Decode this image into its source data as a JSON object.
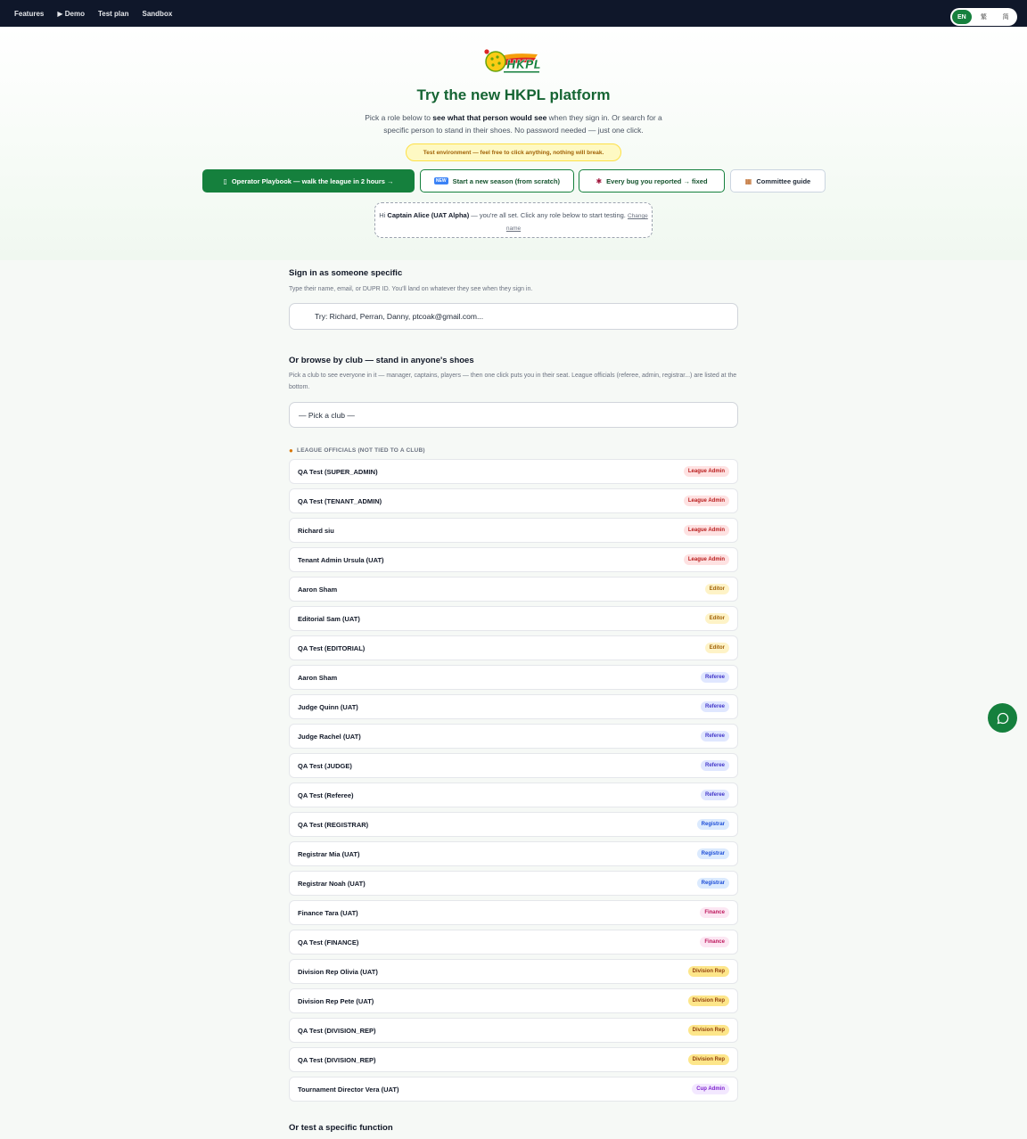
{
  "nav": {
    "links": [
      "Features",
      "▶ Demo",
      "Test plan",
      "Sandbox"
    ],
    "languages": [
      "EN",
      "繁",
      "简"
    ],
    "active_language": "EN"
  },
  "hero": {
    "logo_text": "HKPL",
    "title": "Try the new HKPL platform",
    "subtitle_part1": "Pick a role below to ",
    "subtitle_bold": "see what that person would see",
    "subtitle_part2": " when they sign in. Or search for a specific person to stand in their shoes. No password needed — just one click.",
    "test_env": "Test environment — feel free to click anything, nothing will break.",
    "buttons": {
      "playbook": "Operator Playbook — walk the league in 2 hours →",
      "new_season": "Start a new season (from scratch)",
      "bugs": "Every bug you reported → fixed",
      "committee": "Committee guide"
    },
    "welcome": {
      "hi": "Hi ",
      "name": "Captain Alice (UAT Alpha)",
      "rest": " — you're all set. Click any role below to start testing. ",
      "change": "Change name"
    }
  },
  "sign_in": {
    "title": "Sign in as someone specific",
    "desc": "Type their name, email, or DUPR ID. You'll land on whatever they see when they sign in.",
    "placeholder": "Try: Richard, Perran, Danny, ptcoak@gmail.com..."
  },
  "browse": {
    "title": "Or browse by club — stand in anyone's shoes",
    "desc": "Pick a club to see everyone in it — manager, captains, players — then one click puts you in their seat. League officials (referee, admin, registrar...) are listed at the bottom.",
    "select_value": "— Pick a club —"
  },
  "officials_label": "LEAGUE OFFICIALS (NOT TIED TO A CLUB)",
  "badge_colors": {
    "League Admin": {
      "bg": "#fee2e2",
      "fg": "#b91c1c"
    },
    "Editor": {
      "bg": "#fef3c7",
      "fg": "#a16207"
    },
    "Referee": {
      "bg": "#e0e7ff",
      "fg": "#4338ca"
    },
    "Registrar": {
      "bg": "#dbeafe",
      "fg": "#1d4ed8"
    },
    "Finance": {
      "bg": "#fce7f3",
      "fg": "#be185d"
    },
    "Division Rep": {
      "bg": "#fde68a",
      "fg": "#92400e"
    },
    "Cup Admin": {
      "bg": "#f3e8ff",
      "fg": "#7e22ce"
    }
  },
  "roles": [
    {
      "name": "QA Test (SUPER_ADMIN)",
      "badge": "League Admin"
    },
    {
      "name": "QA Test (TENANT_ADMIN)",
      "badge": "League Admin"
    },
    {
      "name": "Richard siu",
      "badge": "League Admin"
    },
    {
      "name": "Tenant Admin Ursula (UAT)",
      "badge": "League Admin"
    },
    {
      "name": "Aaron Sham",
      "badge": "Editor"
    },
    {
      "name": "Editorial Sam (UAT)",
      "badge": "Editor"
    },
    {
      "name": "QA Test (EDITORIAL)",
      "badge": "Editor"
    },
    {
      "name": "Aaron Sham",
      "badge": "Referee"
    },
    {
      "name": "Judge Quinn (UAT)",
      "badge": "Referee"
    },
    {
      "name": "Judge Rachel (UAT)",
      "badge": "Referee"
    },
    {
      "name": "QA Test (JUDGE)",
      "badge": "Referee"
    },
    {
      "name": "QA Test (Referee)",
      "badge": "Referee"
    },
    {
      "name": "QA Test (REGISTRAR)",
      "badge": "Registrar"
    },
    {
      "name": "Registrar Mia (UAT)",
      "badge": "Registrar"
    },
    {
      "name": "Registrar Noah (UAT)",
      "badge": "Registrar"
    },
    {
      "name": "Finance Tara (UAT)",
      "badge": "Finance"
    },
    {
      "name": "QA Test (FINANCE)",
      "badge": "Finance"
    },
    {
      "name": "Division Rep Olivia (UAT)",
      "badge": "Division Rep"
    },
    {
      "name": "Division Rep Pete (UAT)",
      "badge": "Division Rep"
    },
    {
      "name": "QA Test (DIVISION_REP)",
      "badge": "Division Rep"
    },
    {
      "name": "QA Test (DIVISION_REP)",
      "badge": "Division Rep"
    },
    {
      "name": "Tournament Director Vera (UAT)",
      "badge": "Cup Admin"
    }
  ],
  "function_title": "Or test a specific function"
}
